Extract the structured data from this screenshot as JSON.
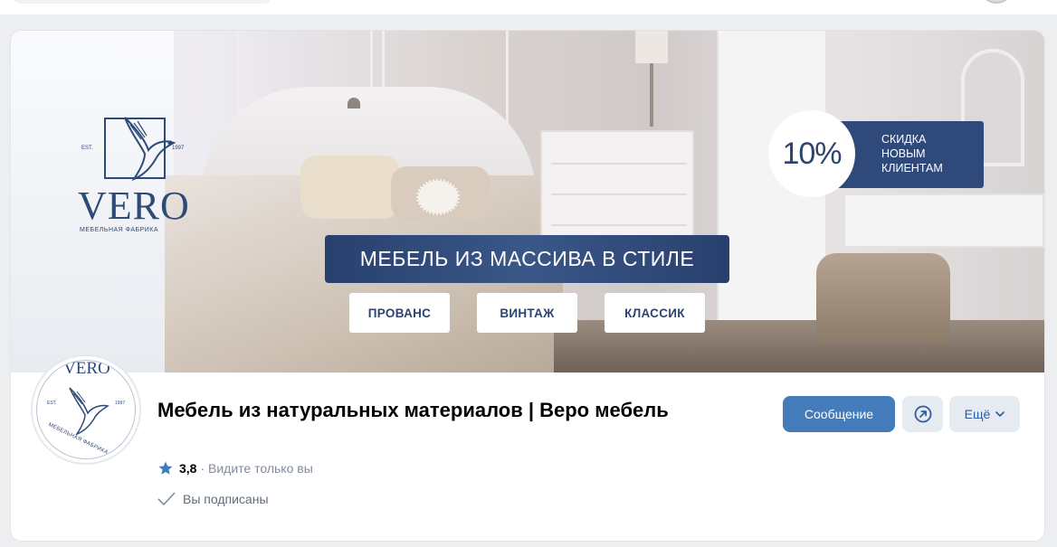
{
  "cover": {
    "logo": {
      "name": "VERO",
      "est": "EST.",
      "year": "1997",
      "subtitle": "МЕБЕЛЬНАЯ ФАБРИКА"
    },
    "discount": {
      "percent": "10%",
      "line1": "СКИДКА",
      "line2": "НОВЫМ",
      "line3": "КЛИЕНТАМ"
    },
    "banner_text": "МЕБЕЛЬ ИЗ МАССИВА В СТИЛЕ",
    "styles": [
      "ПРОВАНС",
      "ВИНТАЖ",
      "КЛАССИК"
    ]
  },
  "avatar": {
    "name": "VERO",
    "est": "EST.",
    "year": "1997",
    "subtitle": "МЕБЕЛЬНАЯ ФАБРИКА"
  },
  "group": {
    "title": "Мебель из натуральных материалов | Веро мебель",
    "rating": "3,8",
    "rating_note": "· Видите только вы",
    "subscribed": "Вы подписаны"
  },
  "actions": {
    "message": "Сообщение",
    "more": "Ещё",
    "share_icon": "share-arrow-icon"
  },
  "colors": {
    "brand_navy": "#2e4a78",
    "accent_blue": "#447bba",
    "secondary_button_bg": "#e5ebf1"
  }
}
